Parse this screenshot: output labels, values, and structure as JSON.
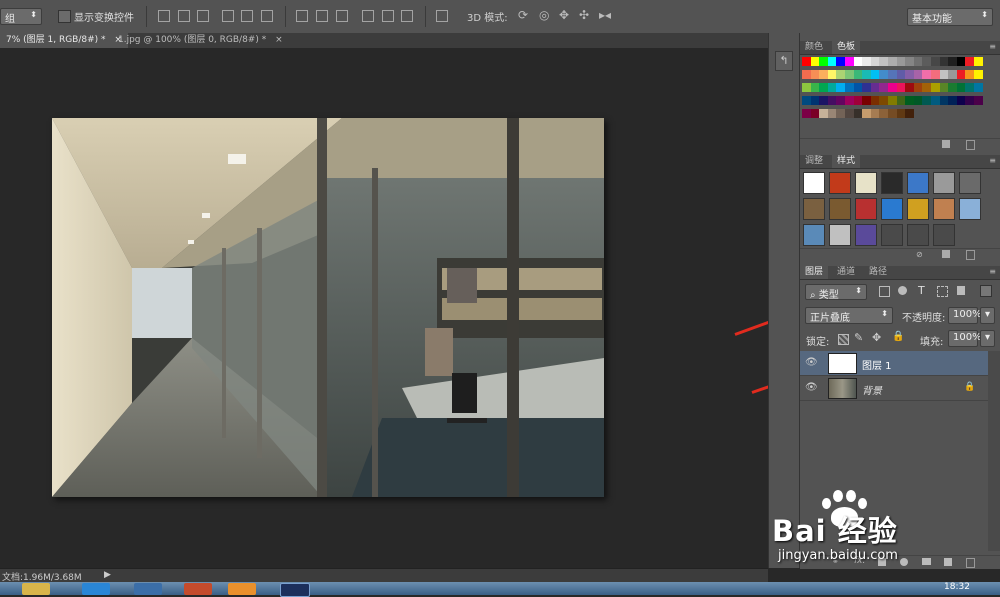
{
  "options_bar": {
    "auto_select_value": "组",
    "show_transform_label": "显示变换控件",
    "mode_3d_label": "3D 模式:",
    "workspace": "基本功能"
  },
  "tabs": [
    {
      "label": "7% (图层 1, RGB/8#) *",
      "close": "×",
      "active": true
    },
    {
      "label": "1.jpg @ 100% (图层 0, RGB/8#) *",
      "close": "×",
      "active": false
    }
  ],
  "color_panel": {
    "tabs": [
      "颜色",
      "色板"
    ],
    "swatches_top": [
      "#ff0000",
      "#ffff00",
      "#00ff00",
      "#00ffff",
      "#0000ff",
      "#ff00ff",
      "#ffffff",
      "#ebebeb",
      "#d6d6d6",
      "#c2c2c2",
      "#adadad",
      "#999999",
      "#858585",
      "#707070",
      "#5c5c5c",
      "#474747",
      "#333333",
      "#1f1f1f",
      "#000000",
      "#ed1c24",
      "#fff200"
    ],
    "swatches_rows": [
      [
        "#f26c4f",
        "#f68e56",
        "#fbaf5d",
        "#fff568",
        "#acd373",
        "#7cc576",
        "#3bb878",
        "#1abbb4",
        "#00bff3",
        "#438ccb",
        "#5574b9",
        "#605ca8",
        "#855fa8",
        "#a763a8",
        "#f06ea9",
        "#f26d7d",
        "#c2c2c2",
        "#999999",
        "#ed1c24",
        "#f7941d",
        "#fff200"
      ],
      [
        "#8dc63f",
        "#39b54a",
        "#00a651",
        "#00a99d",
        "#00aeef",
        "#0072bc",
        "#0054a6",
        "#2e3192",
        "#662d91",
        "#92278f",
        "#ec008c",
        "#ed145b",
        "#9e0b0f",
        "#a0410d",
        "#a36209",
        "#aba000",
        "#598527",
        "#1a7b30",
        "#007236",
        "#00746b",
        "#0076a3"
      ],
      [
        "#004a80",
        "#003471",
        "#1b1464",
        "#440e62",
        "#630460",
        "#9e005d",
        "#9e0039",
        "#790000",
        "#7b2e00",
        "#7d4900",
        "#827b00",
        "#406618",
        "#005e20",
        "#005826",
        "#005952",
        "#005b7f",
        "#003663",
        "#002157",
        "#0d004c",
        "#32004b",
        "#4b0049"
      ],
      [
        "#7b0046",
        "#7a0026",
        "#c7b299",
        "#998675",
        "#736357",
        "#534741",
        "#37302a",
        "#c69c6d",
        "#a67c52",
        "#8c6239",
        "#754c24",
        "#603913",
        "#42210b"
      ]
    ]
  },
  "styles_panel": {
    "tabs": [
      "调整",
      "样式"
    ]
  },
  "layers_panel": {
    "tabs": [
      "图层",
      "通道",
      "路径"
    ],
    "kind_filter": "类型",
    "blend_mode": "正片叠底",
    "opacity_label": "不透明度:",
    "opacity_value": "100%",
    "lock_label": "锁定:",
    "fill_label": "填充:",
    "fill_value": "100%",
    "layers": [
      {
        "name": "图层 1",
        "selected": true
      },
      {
        "name": "背景",
        "selected": false
      }
    ]
  },
  "status": {
    "doc_size": "文档:1.96M/3.68M"
  },
  "watermark": {
    "brand": "Bai  经验",
    "url": "jingyan.baidu.com"
  },
  "taskbar": {
    "clock": "18:32"
  }
}
